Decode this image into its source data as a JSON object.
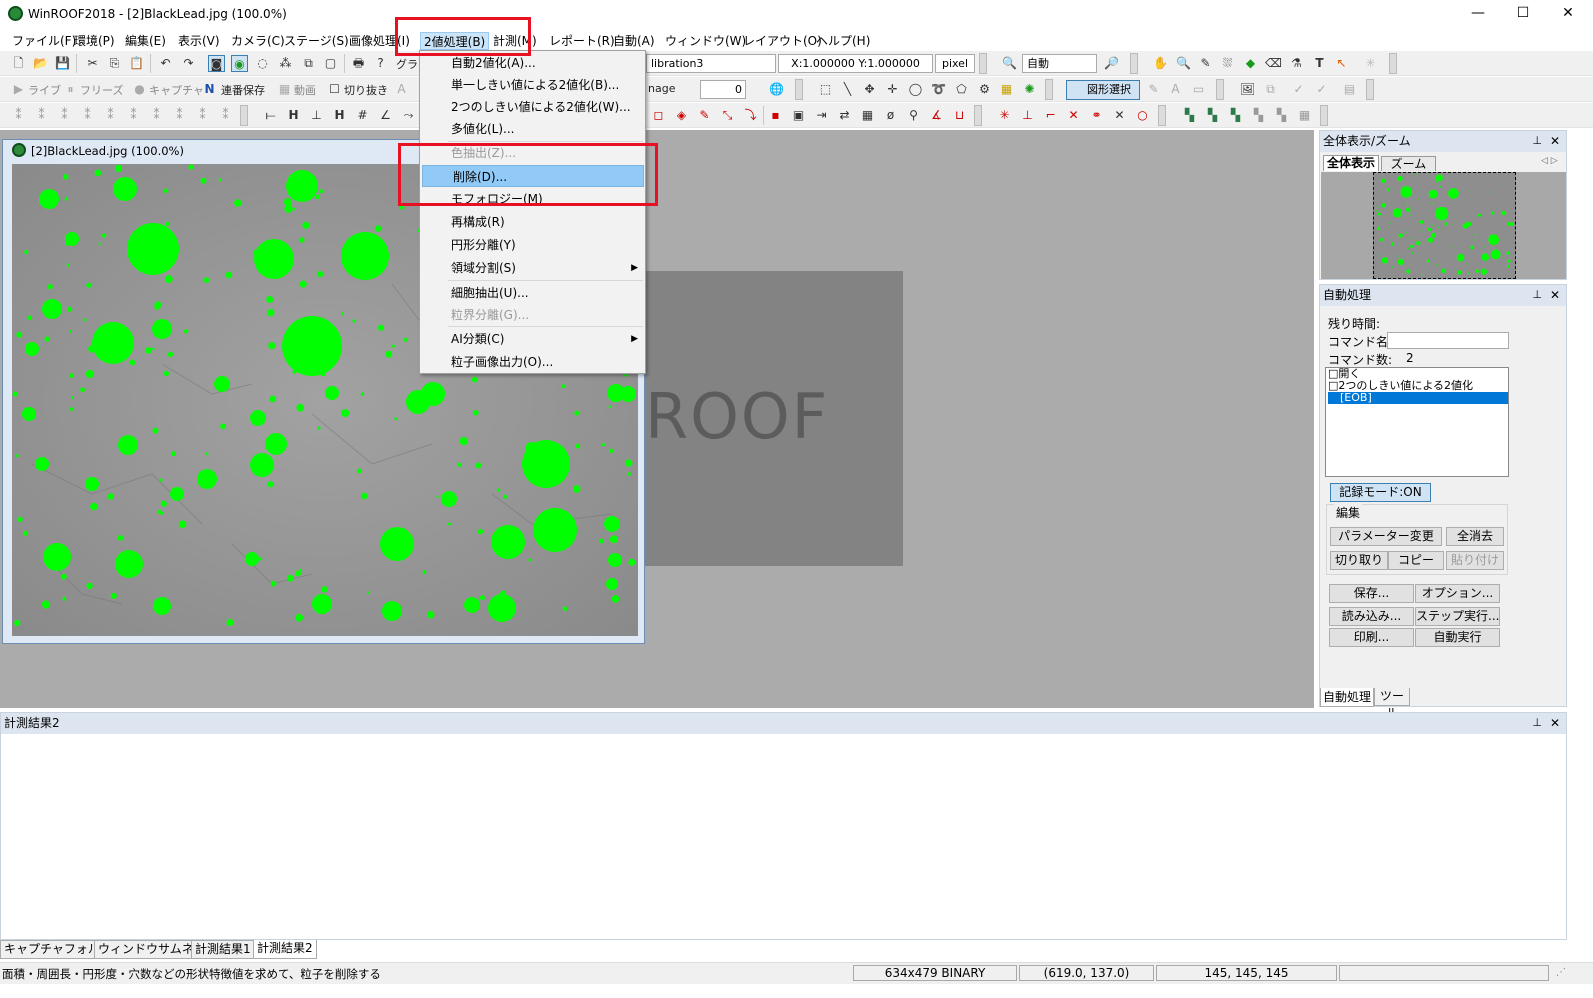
{
  "window": {
    "title": "WinROOF2018 - [2]BlackLead.jpg (100.0%)",
    "minimize": "—",
    "maximize": "☐",
    "close": "✕"
  },
  "menubar": [
    "ファイル(F)",
    "環境(P)",
    "編集(E)",
    "表示(V)",
    "カメラ(C)",
    "ステージ(S)",
    "画像処理(I)",
    "2値処理(B)",
    "計測(M)",
    "レポート(R)",
    "自動(A)",
    "ウィンドウ(W)",
    "レイアウト(O)",
    "ヘルプ(H)"
  ],
  "toolbar1": {
    "graph_label": "グラフ",
    "calibration": "libration3",
    "scale": "X:1.000000 Y:1.000000",
    "unit": "pixel",
    "zoom": "自動"
  },
  "toolbar2": {
    "live": "ライブ",
    "freeze": "フリーズ",
    "capture": "キャプチャ",
    "serial_save": "連番保存",
    "movie": "動画",
    "crop": "切り抜き",
    "image_label": "nage",
    "value": "0",
    "shape_select": "図形選択"
  },
  "image_window": {
    "title": "[2]BlackLead.jpg (100.0%)"
  },
  "background_logo": "ROOF",
  "dropdown": {
    "items": [
      {
        "label": "自動2値化(A)...",
        "disabled": false
      },
      {
        "label": "単一しきい値による2値化(B)...",
        "disabled": false
      },
      {
        "label": "2つのしきい値による2値化(W)...",
        "disabled": false
      },
      {
        "label": "多値化(L)...",
        "disabled": false
      },
      {
        "label": "色抽出(Z)...",
        "disabled": true
      },
      {
        "label": "削除(D)...",
        "disabled": false,
        "highlight": true
      },
      {
        "label": "モフォロジー(M)",
        "disabled": false
      },
      {
        "label": "再構成(R)",
        "disabled": false
      },
      {
        "label": "円形分離(Y)",
        "disabled": false
      },
      {
        "label": "領域分割(S)",
        "disabled": false,
        "submenu": true
      },
      {
        "label": "細胞抽出(U)...",
        "disabled": false
      },
      {
        "label": "粒界分離(G)...",
        "disabled": true
      },
      {
        "label": "AI分類(C)",
        "disabled": false,
        "submenu": true
      },
      {
        "label": "粒子画像出力(O)...",
        "disabled": false
      }
    ]
  },
  "overview_panel": {
    "title": "全体表示/ズーム",
    "tab_overview": "全体表示",
    "tab_zoom": "ズーム"
  },
  "auto_panel": {
    "title": "自動処理",
    "remaining_label": "残り時間:",
    "command_name_label": "コマンド名:",
    "command_count_label": "コマンド数:",
    "command_count": "2",
    "commands": [
      "□開く",
      "□2つのしきい値による2値化",
      "[EOB]"
    ],
    "record_mode": "記録モード:ON",
    "edit_group": "編集",
    "param_change": "パラメーター変更",
    "clear_all": "全消去",
    "cut": "切り取り",
    "copy": "コピー",
    "paste": "貼り付け",
    "save": "保存...",
    "option": "オプション...",
    "load": "読み込み...",
    "step_run": "ステップ実行...",
    "print": "印刷...",
    "auto_run": "自動実行",
    "tab_auto": "自動処理",
    "tab_tool": "ツール"
  },
  "results_panel": {
    "title": "計測結果2"
  },
  "bottom_tabs": [
    "キャプチャフォルダー",
    "ウィンドウサムネイル",
    "計測結果1",
    "計測結果2"
  ],
  "status": {
    "message": "面積・周囲長・円形度・穴数などの形状特徴値を求めて、粒子を削除する",
    "image_info": "634x479 BINARY",
    "coords": "(619.0, 137.0)",
    "rgb": "145, 145, 145"
  },
  "colors": {
    "particle": "#00ff00",
    "highlight_box": "#e81123",
    "menu_highlight": "#91c9f7",
    "selection": "#0078d7"
  }
}
